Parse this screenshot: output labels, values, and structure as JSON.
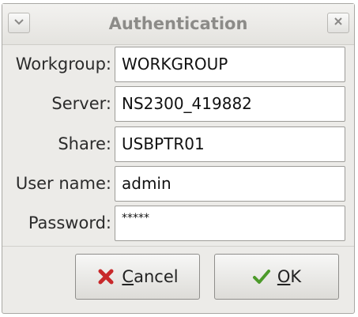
{
  "window": {
    "title": "Authentication",
    "menu_icon": "chevron-down-icon",
    "close_icon": "close-icon"
  },
  "form": {
    "fields": [
      {
        "label": "Workgroup:",
        "value": "WORKGROUP"
      },
      {
        "label": "Server:",
        "value": "NS2300_419882"
      },
      {
        "label": "Share:",
        "value": "USBPTR01"
      },
      {
        "label": "User name:",
        "value": "admin"
      },
      {
        "label": "Password:",
        "value": "*****"
      }
    ]
  },
  "buttons": {
    "cancel": {
      "mnemonic": "C",
      "rest": "ancel",
      "icon": "cancel-x-icon",
      "color": "#c8282a"
    },
    "ok": {
      "mnemonic": "O",
      "rest": "K",
      "icon": "checkmark-icon",
      "color": "#4c9a2a"
    }
  }
}
